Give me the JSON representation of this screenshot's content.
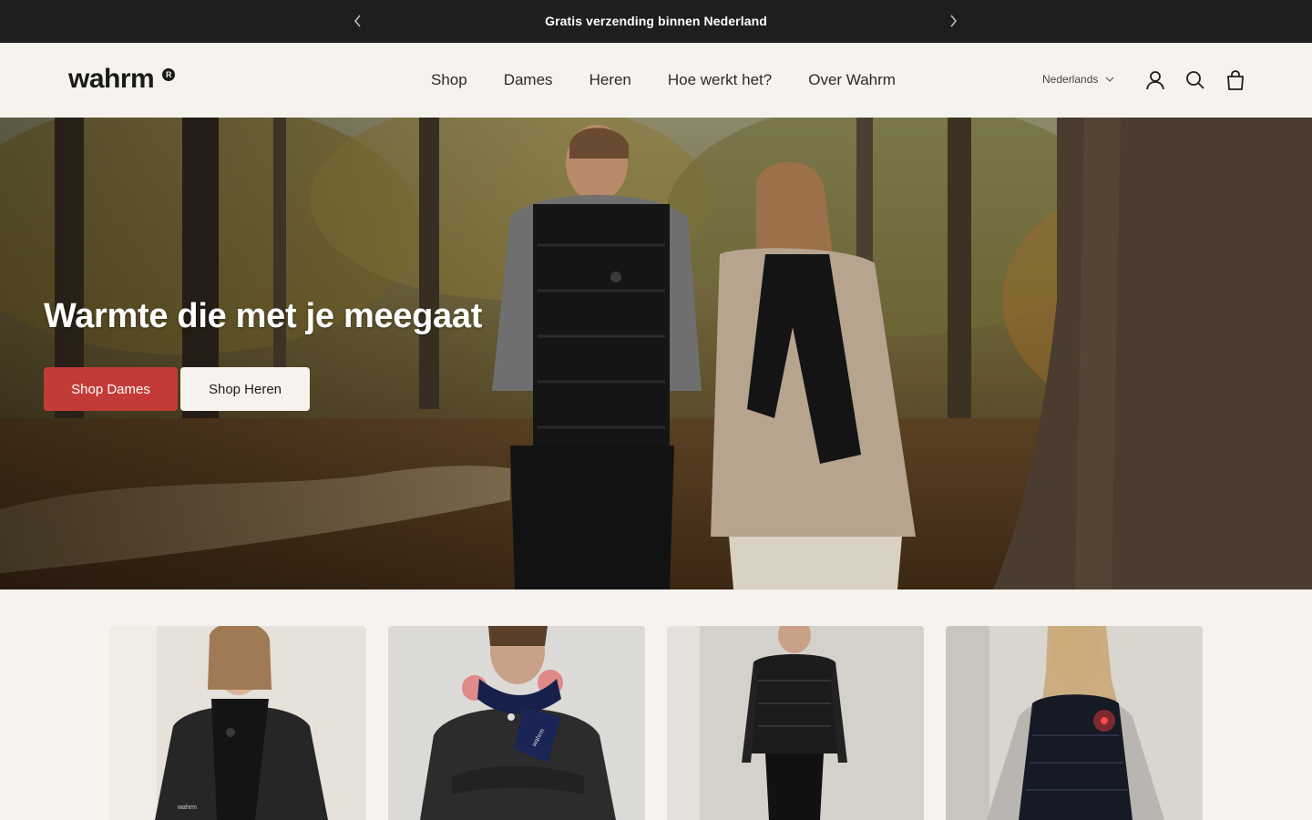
{
  "announcement": {
    "message": "Gratis verzending binnen Nederland",
    "prev_icon": "chevron-left-icon",
    "next_icon": "chevron-right-icon"
  },
  "header": {
    "logo_text": "wahrm",
    "logo_mark": "R",
    "nav": [
      "Shop",
      "Dames",
      "Heren",
      "Hoe werkt het?",
      "Over Wahrm"
    ],
    "language": "Nederlands",
    "icons": [
      "account-icon",
      "search-icon",
      "bag-icon"
    ]
  },
  "hero": {
    "title": "Warmte die met je meegaat",
    "buttons": {
      "dames": "Shop Dames",
      "heren": "Shop Heren"
    },
    "accent_color": "#c23b36"
  },
  "products": [
    {
      "image": "woman-black-scarf-photo",
      "label_on_product": "wahrm"
    },
    {
      "image": "man-navy-heated-scarf-photo",
      "label_on_product": "wahrm"
    },
    {
      "image": "man-black-puffer-vest-photo"
    },
    {
      "image": "woman-navy-heated-vest-photo"
    }
  ],
  "colors": {
    "announcement_bg": "#1e1e1e",
    "page_bg": "#f6f3ee",
    "primary_button": "#c23b36"
  }
}
